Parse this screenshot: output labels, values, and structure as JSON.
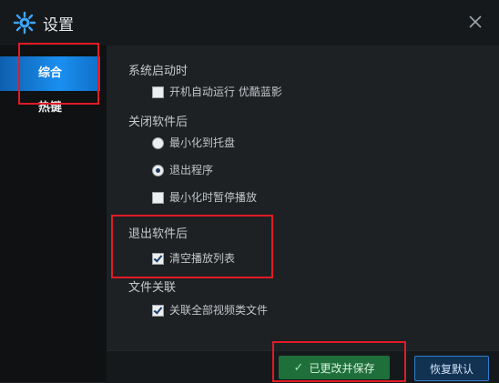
{
  "window": {
    "title": "设置"
  },
  "sidebar": {
    "items": [
      {
        "label": "综合",
        "active": true
      },
      {
        "label": "热键",
        "active": false
      }
    ]
  },
  "sections": {
    "startup": {
      "title": "系统启动时",
      "autostart_label": "开机自动运行 优酷蓝影",
      "autostart_checked": false
    },
    "close": {
      "title": "关闭软件后",
      "minimize_tray_label": "最小化到托盘",
      "exit_label": "退出程序",
      "exit_selected": true,
      "pause_label": "最小化时暂停播放",
      "pause_checked": false
    },
    "after_exit": {
      "title": "退出软件后",
      "clear_playlist_label": "清空播放列表",
      "clear_playlist_checked": true
    },
    "file_assoc": {
      "title": "文件关联",
      "assoc_all_label": "关联全部视频类文件",
      "assoc_all_checked": true
    }
  },
  "footer": {
    "save_label": "已更改并保存",
    "restore_label": "恢复默认"
  },
  "colors": {
    "accent": "#1a8ff0",
    "save_green": "#1e6f3a",
    "annotation_red": "#e11b25"
  }
}
